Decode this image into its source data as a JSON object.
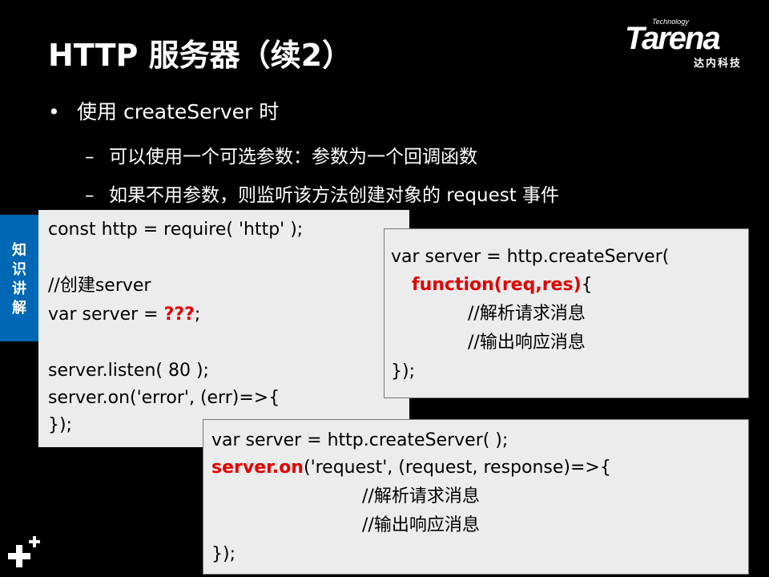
{
  "title": "HTTP 服务器（续2）",
  "logo": {
    "technology": "Technology",
    "brand": "Tarena",
    "subtitle": "达内科技"
  },
  "bullets": {
    "main": {
      "marker": "•",
      "text": "使用 createServer 时"
    },
    "sub": [
      {
        "marker": "–",
        "text": "可以使用一个可选参数：参数为一个回调函数"
      },
      {
        "marker": "–",
        "text": "如果不用参数，则监听该方法创建对象的 request 事件"
      }
    ]
  },
  "side_tab": {
    "chars": [
      "知",
      "识",
      "讲",
      "解"
    ]
  },
  "code_box_1": {
    "lines": [
      "const http = require( 'http' );",
      "",
      "//创建server",
      "var server = ",
      "",
      "server.listen( 80 );",
      "server.on('error', (err)=>{",
      "});"
    ],
    "highlight": "???",
    "line4_suffix": ";"
  },
  "code_box_2": {
    "line1": "var server = http.createServer(",
    "highlight": "function(req,res)",
    "line2_suffix": "{",
    "line3": "//解析请求消息",
    "line4": "//输出响应消息",
    "line5": "});"
  },
  "code_box_3": {
    "line1": "var server = http.createServer( );",
    "highlight": "server.on",
    "line2_suffix": "('request', (request, response)=>{",
    "line3": "//解析请求消息",
    "line4": "//输出响应消息",
    "line5": "});"
  },
  "colors": {
    "background": "#000000",
    "code_bg": "#ececec",
    "highlight": "#e00000",
    "side_tab": "#0067b4"
  },
  "icons": {
    "corner": "plus-icon"
  }
}
